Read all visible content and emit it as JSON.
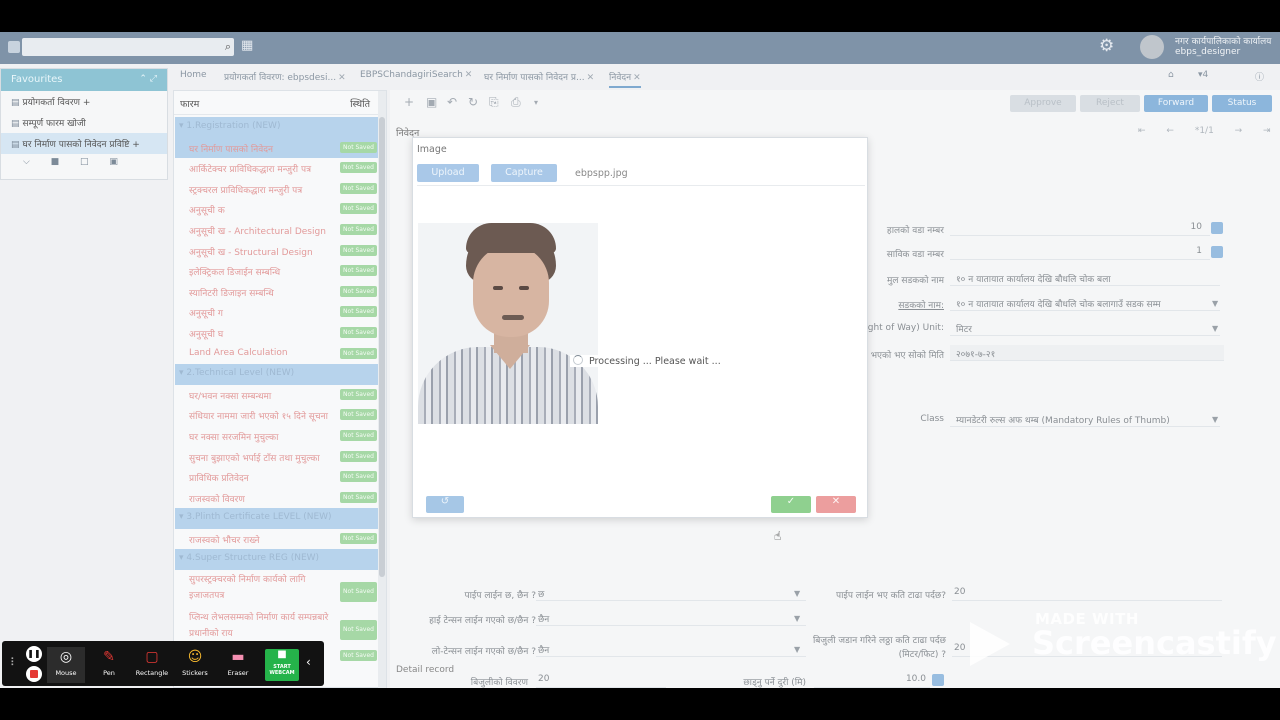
{
  "header": {
    "org_name": "नगर कार्यपालिकाको कार्यालय",
    "user_name": "ebps_designer"
  },
  "favourites": {
    "title": "Favourites",
    "items": [
      {
        "label": "प्रयोगकर्ता विवरण"
      },
      {
        "label": "सम्पूर्ण फारम खोजी"
      },
      {
        "label": "घर निर्माण पासको निवेदन प्रविष्टि"
      }
    ]
  },
  "tabs": [
    {
      "label": "Home"
    },
    {
      "label": "प्रयोगकर्ता विवरण: ebpsdesi..."
    },
    {
      "label": "EBPSChandagiriSearch"
    },
    {
      "label": "घर निर्माण पासको निवेदन प्र..."
    },
    {
      "label": "निवेदन"
    }
  ],
  "tab_count": "4",
  "tree": {
    "col_form": "फारम",
    "col_status": "स्थिति",
    "badge": "Not Saved",
    "rows": [
      {
        "type": "sec",
        "label": "1.Registration (NEW)"
      },
      {
        "type": "cur",
        "label": "घर निर्माण पासको निवेदन"
      },
      {
        "label": "आर्किटेक्चर प्राविधिकद्धारा मन्जुरी पत्र"
      },
      {
        "label": "स्ट्रक्चरल प्राविधिकद्धारा मन्जुरी पत्र"
      },
      {
        "label": "अनुसूची क"
      },
      {
        "label": "अनुसूची ख - Architectural Design"
      },
      {
        "label": "अनुसूची ख - Structural Design"
      },
      {
        "label": "इलेक्ट्रिकल डिजाईन सम्बन्धि"
      },
      {
        "label": "स्यानिटरी डिजाइन सम्बन्धि"
      },
      {
        "label": "अनुसूची ग"
      },
      {
        "label": "अनुसूची घ"
      },
      {
        "label": "Land Area Calculation"
      },
      {
        "type": "sec",
        "label": "2.Technical Level (NEW)"
      },
      {
        "label": "घर/भवन नक्सा सम्बन्धमा"
      },
      {
        "label": "संधियार नाममा जारी भएको १५ दिने सूचना"
      },
      {
        "label": "घर नक्सा सरजमिन मुचुल्का"
      },
      {
        "label": "सुचना बुझाएको भर्पाई टाँस तथा मुचुल्का"
      },
      {
        "label": "प्राविधिक प्रतिवेदन"
      },
      {
        "label": "राजस्वको विवरण"
      },
      {
        "type": "sec",
        "label": "3.Plinth Certificate LEVEL (NEW)"
      },
      {
        "label": "राजस्वको भौचर राख्ने"
      },
      {
        "type": "sec",
        "label": "4.Super Structure REG (NEW)"
      },
      {
        "type": "tall",
        "label": "सुपरस्ट्रक्चरको निर्माण कार्यको लागि इजाजतपत्र"
      },
      {
        "type": "tall",
        "label": "प्लिन्थ लेभलसम्मको निर्माण कार्य सम्पन्नबारे प्रधानीको राय"
      },
      {
        "label": ""
      }
    ]
  },
  "toolbar": {
    "approve": "Approve",
    "reject": "Reject",
    "forward": "Forward",
    "status": "Status"
  },
  "form": {
    "title": "निवेदन",
    "pager": "*1/1",
    "fields": {
      "ward_now_label": "हालको वडा नम्बर",
      "ward_now_value": "10",
      "ward_old_label": "साविक वडा नम्बर",
      "ward_old_value": "1",
      "main_road_label": "मुल सडकको नाम",
      "main_road_value": "१० न यातायात कार्यालय देखि बौधलि चोक बला",
      "road_name_label": "सडकको नाम:",
      "road_name_value": "१० न यातायात कार्यालय देखि बौधलि चोक बलागाउँ सडक सम्म",
      "row_unit_label": "Right of Way) Unit:",
      "row_unit_value": "मिटर",
      "date_label": "भएको भए सोको मिति",
      "date_value": "२०७१-७-२१",
      "class_label": "Class",
      "class_value": "म्यानडेटरी रुल्स अफ थम्ब (Mandatory Rules of Thumb)",
      "pipe_label": "पाईप लाईन छ, छैन ?",
      "pipe_value": "छ",
      "pipe_dist_label": "पाईप लाईन भए कति टाढा पर्दछ?",
      "pipe_dist_value": "20",
      "ht_label": "हाई टेन्सन लाईन गएको छ/छैन ?",
      "ht_value": "छैन",
      "lt_label": "लो-टेन्सन लाईन गएको छ/छैन ?",
      "lt_value": "छैन",
      "pole_label": "बिजुली जडान गरिने लठ्ठा कति टाढा पर्दछ (मिटर/फिट) ?",
      "pole_value": "20",
      "elec_label": "बिजुलीको विवरण",
      "elec_value": "20",
      "setback_label": "छाड्नु पर्ने दुरी (मि)",
      "setback_value": "10.0"
    },
    "detail_record": "Detail record"
  },
  "modal": {
    "title": "Image",
    "upload": "Upload",
    "capture": "Capture",
    "filename": "ebpspp.jpg",
    "processing": "Processing ... Please wait ..."
  },
  "screencastify": {
    "tools": [
      {
        "label": "Mouse"
      },
      {
        "label": "Pen"
      },
      {
        "label": "Rectangle"
      },
      {
        "label": "Stickers"
      },
      {
        "label": "Eraser"
      }
    ],
    "webcam_l1": "START",
    "webcam_l2": "WEBCAM"
  },
  "watermark": {
    "line1": "MADE WITH",
    "line2": "Screencastify"
  }
}
